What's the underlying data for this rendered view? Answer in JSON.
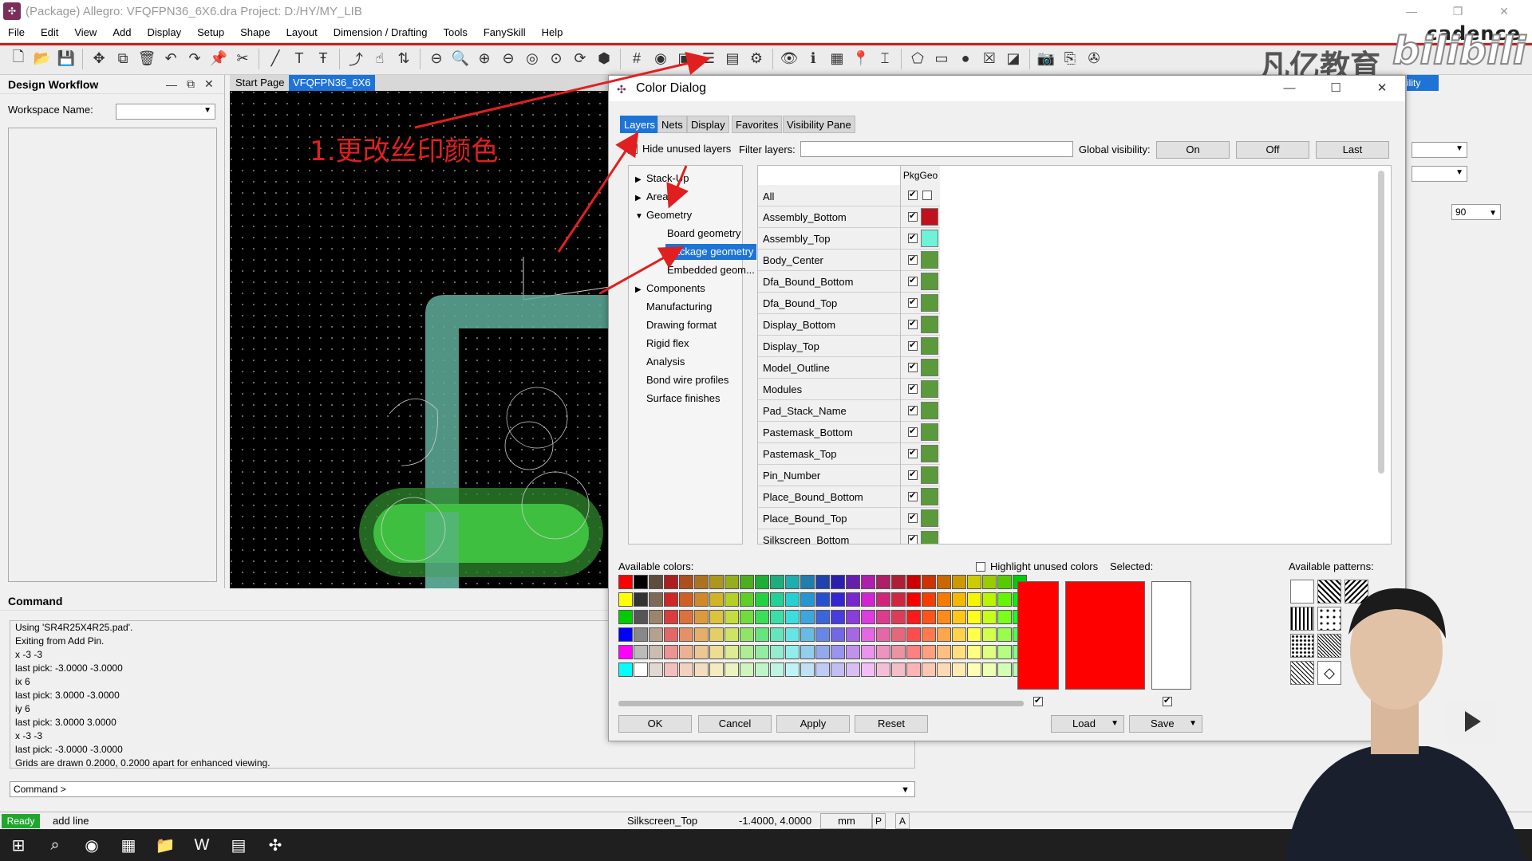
{
  "window": {
    "title": "(Package) Allegro: VFQFPN36_6X6.dra  Project: D:/HY/MY_LIB",
    "brand": "cadence",
    "watermark_cn": "凡亿教育",
    "watermark_logo": "bilibili"
  },
  "menu": [
    "File",
    "Edit",
    "View",
    "Add",
    "Display",
    "Setup",
    "Shape",
    "Layout",
    "Dimension / Drafting",
    "Tools",
    "FanySkill",
    "Help"
  ],
  "workflow": {
    "title": "Design Workflow",
    "workspace_label": "Workspace Name:",
    "workspace_value": ""
  },
  "doc_tabs": [
    "Start Page",
    "VFQFPN36_6X6"
  ],
  "annotation": "1.更改丝印颜色",
  "command": {
    "title": "Command",
    "log": [
      "Using 'SR4R25X4R25.pad'.",
      "Exiting from Add Pin.",
      "x -3 -3",
      "last pick:  -3.0000 -3.0000",
      "ix 6",
      "last pick:  3.0000 -3.0000",
      "iy 6",
      "last pick:  3.0000 3.0000",
      "x -3 -3",
      "last pick:  -3.0000 -3.0000",
      "Grids are drawn 0.2000, 0.2000 apart for enhanced viewing."
    ],
    "prompt": "Command >"
  },
  "status": {
    "state": "Ready",
    "command": "add line",
    "layer": "Silkscreen_Top",
    "coords": "-1.4000, 4.0000",
    "units": "mm",
    "btn_p": "P",
    "btn_a": "A"
  },
  "right_panel": {
    "value_90": "90",
    "visibility_tab": "ility"
  },
  "dialog": {
    "title": "Color Dialog",
    "tabs": [
      "Layers",
      "Nets",
      "Display",
      "Favorites",
      "Visibility Pane"
    ],
    "active_tab": "Layers",
    "hide_unused_label": "Hide unused layers",
    "filter_label": "Filter layers:",
    "filter_value": "",
    "global_visibility_label": "Global visibility:",
    "global_buttons": [
      "On",
      "Off",
      "Last"
    ],
    "tree": [
      {
        "label": "Stack-Up",
        "expander": "▶"
      },
      {
        "label": "Areas",
        "expander": "▶"
      },
      {
        "label": "Geometry",
        "expander": "▼"
      },
      {
        "label": "Board geometry",
        "child": true
      },
      {
        "label": "Package geometry",
        "child": true,
        "selected": true
      },
      {
        "label": "Embedded geom...",
        "child": true
      },
      {
        "label": "Components",
        "expander": "▶"
      },
      {
        "label": "Manufacturing"
      },
      {
        "label": "Drawing format"
      },
      {
        "label": "Rigid flex"
      },
      {
        "label": "Analysis"
      },
      {
        "label": "Bond wire profiles"
      },
      {
        "label": "Surface finishes"
      }
    ],
    "grid_header": "PkgGeo",
    "all_label": "All",
    "layers": [
      {
        "name": "Assembly_Bottom",
        "color": "#c0121c"
      },
      {
        "name": "Assembly_Top",
        "color": "#6ff2d8"
      },
      {
        "name": "Body_Center",
        "color": "#5a9a3a"
      },
      {
        "name": "Dfa_Bound_Bottom",
        "color": "#5a9a3a"
      },
      {
        "name": "Dfa_Bound_Top",
        "color": "#5a9a3a"
      },
      {
        "name": "Display_Bottom",
        "color": "#5a9a3a"
      },
      {
        "name": "Display_Top",
        "color": "#5a9a3a"
      },
      {
        "name": "Model_Outline",
        "color": "#5a9a3a"
      },
      {
        "name": "Modules",
        "color": "#5a9a3a"
      },
      {
        "name": "Pad_Stack_Name",
        "color": "#5a9a3a"
      },
      {
        "name": "Pastemask_Bottom",
        "color": "#5a9a3a"
      },
      {
        "name": "Pastemask_Top",
        "color": "#5a9a3a"
      },
      {
        "name": "Pin_Number",
        "color": "#5a9a3a"
      },
      {
        "name": "Place_Bound_Bottom",
        "color": "#5a9a3a"
      },
      {
        "name": "Place_Bound_Top",
        "color": "#5a9a3a"
      },
      {
        "name": "Silkscreen_Bottom",
        "color": "#5a9a3a"
      }
    ],
    "available_colors_label": "Available colors:",
    "highlight_unused_label": "Highlight unused colors",
    "selected_label": "Selected:",
    "available_patterns_label": "Available patterns:",
    "selected_color": "#ff0000",
    "buttons": [
      "OK",
      "Cancel",
      "Apply",
      "Reset"
    ],
    "load_label": "Load",
    "save_label": "Save"
  },
  "colors": {
    "accent": "#1e73d6",
    "silkscreen": "#3fbf3f",
    "teal": "#5fae9a",
    "annotation_red": "#e02020"
  }
}
